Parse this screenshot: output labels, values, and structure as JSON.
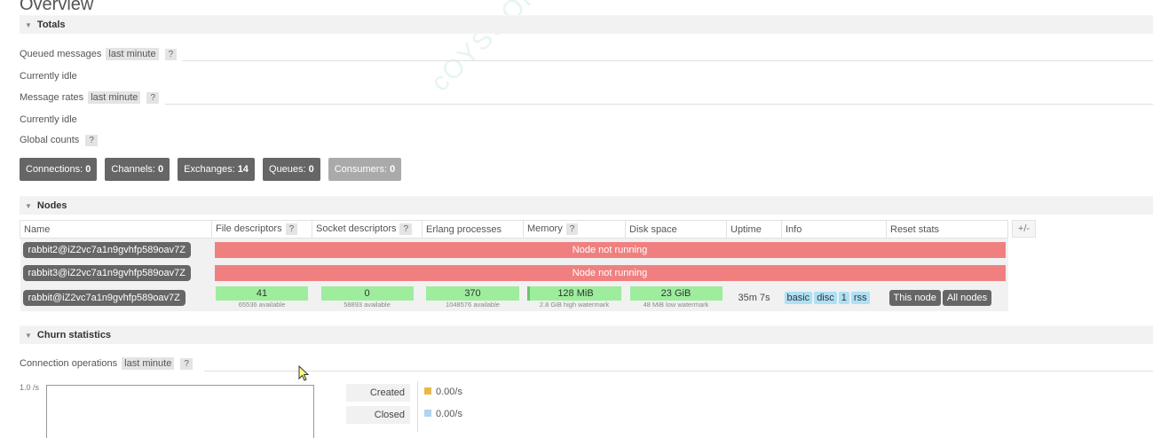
{
  "page": {
    "title": "Overview",
    "watermark": "cOYSOOl"
  },
  "totals": {
    "header": "Totals",
    "queued_label": "Queued messages",
    "queued_range": "last minute",
    "queued_status": "Currently idle",
    "rates_label": "Message rates",
    "rates_range": "last minute",
    "rates_status": "Currently idle",
    "global_label": "Global counts",
    "help": "?"
  },
  "counts": {
    "connections_label": "Connections:",
    "connections": "0",
    "channels_label": "Channels:",
    "channels": "0",
    "exchanges_label": "Exchanges:",
    "exchanges": "14",
    "queues_label": "Queues:",
    "queues": "0",
    "consumers_label": "Consumers:",
    "consumers": "0"
  },
  "nodes": {
    "header": "Nodes",
    "columns": [
      "Name",
      "File descriptors",
      "Socket descriptors",
      "Erlang processes",
      "Memory",
      "Disk space",
      "Uptime",
      "Info",
      "Reset stats"
    ],
    "help": "?",
    "plus_minus": "+/-",
    "not_running": "Node not running",
    "rows": [
      {
        "name": "rabbit2@iZ2vc7a1n9gvhfp589oav7Z"
      },
      {
        "name": "rabbit3@iZ2vc7a1n9gvhfp589oav7Z"
      },
      {
        "name": "rabbit@iZ2vc7a1n9gvhfp589oav7Z",
        "fd": "41",
        "fd_sub": "65536 available",
        "sockets": "0",
        "sockets_sub": "58893 available",
        "erlang": "370",
        "erlang_sub": "1048576 available",
        "memory": "128 MiB",
        "memory_sub": "2.8 GiB high watermark",
        "disk": "23 GiB",
        "disk_sub": "48 MiB low watermark",
        "uptime": "35m 7s",
        "info": [
          "basic",
          "disc",
          "1",
          "rss"
        ],
        "reset_this": "This node",
        "reset_all": "All nodes"
      }
    ]
  },
  "churn": {
    "header": "Churn statistics",
    "conn_label": "Connection operations",
    "conn_range": "last minute",
    "help": "?",
    "y_tick": "1.0 /s",
    "legend": [
      {
        "label": "Created",
        "value": "0.00/s",
        "color": "#e8b84a"
      },
      {
        "label": "Closed",
        "value": "0.00/s",
        "color": "#aed4ef"
      }
    ]
  },
  "colors": {
    "not_running": "#f08080",
    "metric_ok": "#9ded9d",
    "info_badge": "#aee0f5",
    "button_dark": "#666666"
  }
}
